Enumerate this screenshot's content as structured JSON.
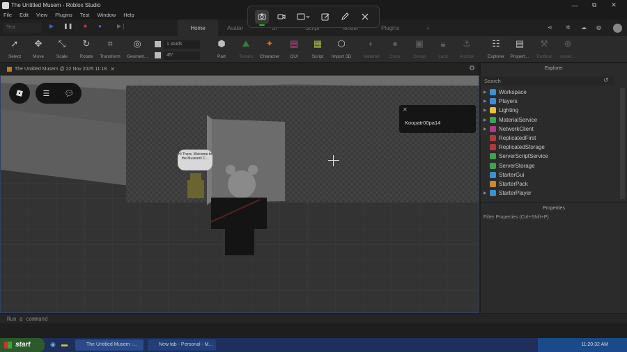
{
  "window": {
    "title": "The Untitled Musem - Roblox Studio",
    "controls": [
      "—",
      "⧉",
      "✕"
    ]
  },
  "menu": [
    "File",
    "Edit",
    "View",
    "Plugins",
    "Test",
    "Window",
    "Help"
  ],
  "snipping_tool": {
    "buttons": [
      "camera-icon",
      "video-icon",
      "rectangle-mode-icon",
      "edit-image-icon",
      "pen-icon",
      "close-icon"
    ],
    "selected": "camera-icon"
  },
  "test_selector": "Test",
  "ribbon_tabs": [
    "Home",
    "Avatar",
    "UI",
    "Script",
    "Model",
    "Plugins",
    "+"
  ],
  "ribbon_tabs_active": "Home",
  "tools": [
    {
      "label": "Select"
    },
    {
      "label": "Move"
    },
    {
      "label": "Scale"
    },
    {
      "label": "Rotate"
    },
    {
      "label": "Transform"
    },
    {
      "label": "Geometr..."
    },
    {
      "label": "Part"
    },
    {
      "label": "Terrain"
    },
    {
      "label": "Character"
    },
    {
      "label": "GUI"
    },
    {
      "label": "Script"
    },
    {
      "label": "Import 3D"
    },
    {
      "label": "Material"
    },
    {
      "label": "Color"
    },
    {
      "label": "Group"
    },
    {
      "label": "Lock"
    },
    {
      "label": "Anchor"
    },
    {
      "label": "Explorer"
    },
    {
      "label": "Propert..."
    },
    {
      "label": "Toolbox"
    },
    {
      "label": "Asset..."
    }
  ],
  "snap": {
    "move": "1 studs",
    "rotate": "45°"
  },
  "document_tab": "The Untitled Musem @ 22 Nov 2025 11:18",
  "viewport": {
    "player_name": "Koopatr00pa14",
    "chat_bubble": "Hi There, Welcome to the Museum! C..."
  },
  "explorer": {
    "title": "Explorer",
    "search_placeholder": "Search",
    "items": [
      {
        "name": "Workspace",
        "color": "#3d8fd6"
      },
      {
        "name": "Players",
        "color": "#3d8fd6"
      },
      {
        "name": "Lighting",
        "color": "#e8c23a"
      },
      {
        "name": "MaterialService",
        "color": "#3fa34d"
      },
      {
        "name": "NetworkClient",
        "color": "#b03a8a"
      },
      {
        "name": "ReplicatedFirst",
        "color": "#b03a3a"
      },
      {
        "name": "ReplicatedStorage",
        "color": "#b03a3a"
      },
      {
        "name": "ServerScriptService",
        "color": "#3fa34d"
      },
      {
        "name": "ServerStorage",
        "color": "#3fa34d"
      },
      {
        "name": "StarterGui",
        "color": "#3d8fd6"
      },
      {
        "name": "StarterPack",
        "color": "#c98a2e"
      },
      {
        "name": "StarterPlayer",
        "color": "#3d8fd6"
      }
    ]
  },
  "properties": {
    "title": "Properties",
    "filter_placeholder": "Filter Properties (Ctrl+Shift+P)"
  },
  "command_bar": {
    "placeholder": "Run a command"
  },
  "taskbar": {
    "start": "start",
    "items": [
      "The Untitled Musem -...",
      "New tab - Personal - M..."
    ],
    "clock": "11:20:32 AM"
  }
}
